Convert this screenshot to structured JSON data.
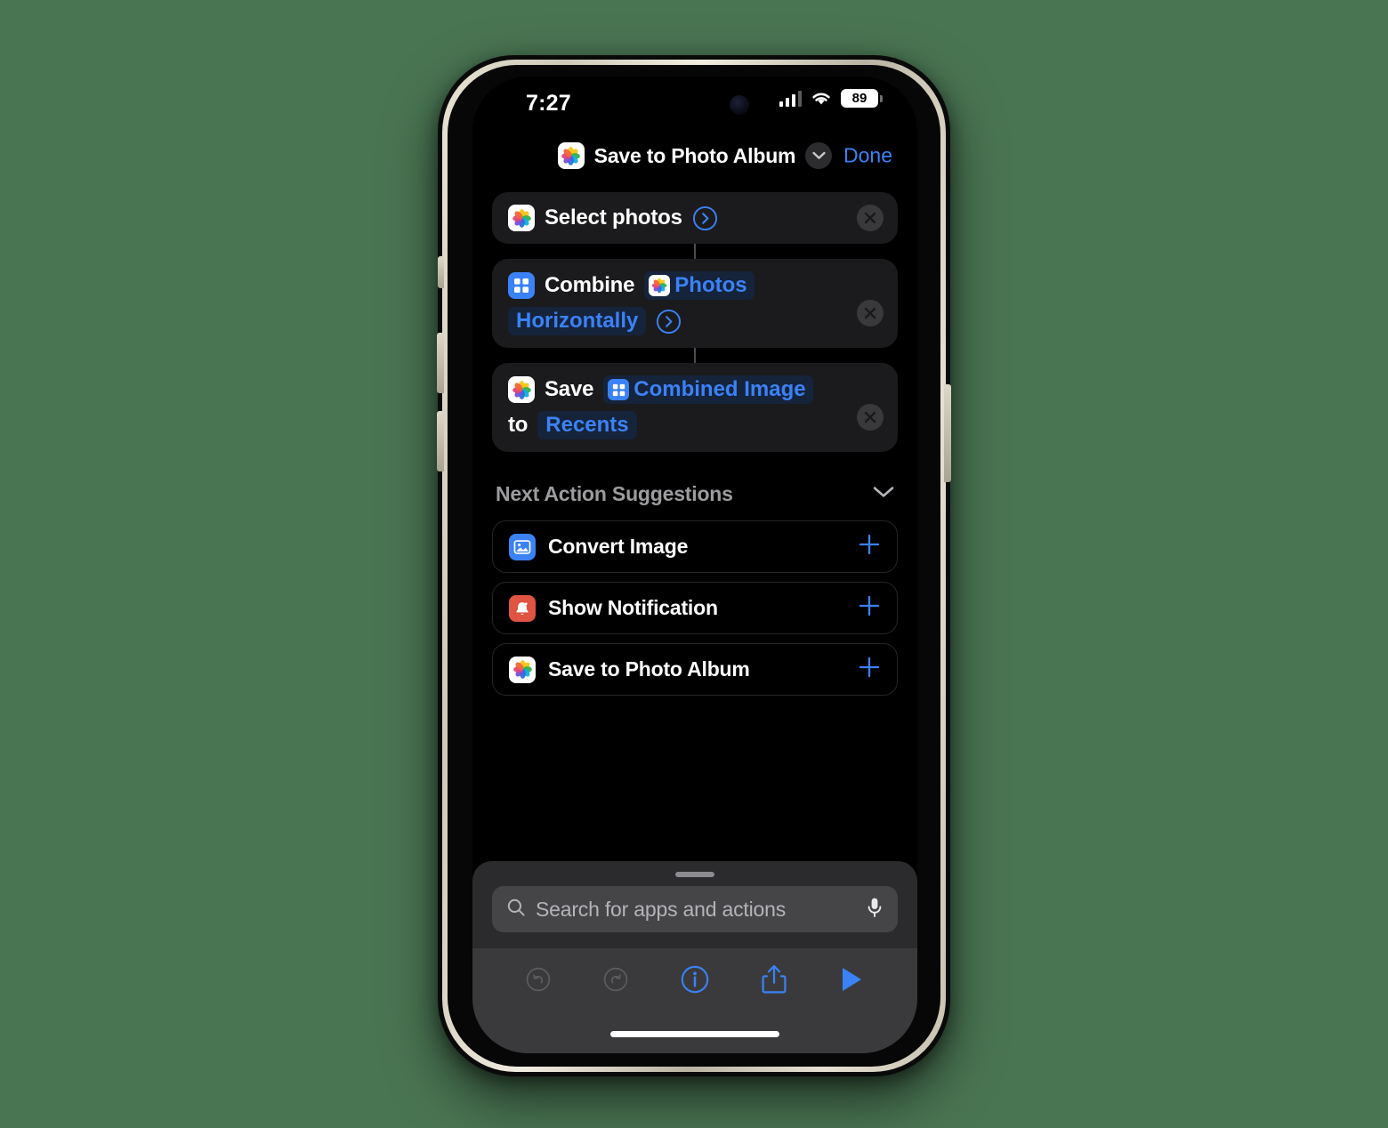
{
  "background_color": "#4a7553",
  "statusbar": {
    "time": "7:27",
    "battery_level": "89",
    "signal_icon": "cellular-bars-icon",
    "wifi_icon": "wifi-icon",
    "battery_icon": "battery-icon"
  },
  "navbar": {
    "app_icon": "photos-app-icon",
    "title": "Save to Photo Album",
    "dropdown_icon": "chevron-down-icon",
    "done_label": "Done"
  },
  "actions": [
    {
      "icon": "photos-app-icon",
      "icon_style": "photos",
      "lines": [
        {
          "parts": [
            {
              "kind": "text",
              "text": "Select photos"
            },
            {
              "kind": "go",
              "icon": "chevron-right-circle-icon"
            }
          ]
        }
      ],
      "close_icon": "close-circle-icon"
    },
    {
      "icon": "grid-icon",
      "icon_style": "blue-grid",
      "lines": [
        {
          "parts": [
            {
              "kind": "text",
              "text": "Combine"
            },
            {
              "kind": "token-icon",
              "text": "Photos",
              "icon": "photos-app-icon"
            }
          ]
        },
        {
          "parts": [
            {
              "kind": "token",
              "text": "Horizontally"
            },
            {
              "kind": "go",
              "icon": "chevron-right-circle-icon"
            }
          ]
        }
      ],
      "close_icon": "close-circle-icon"
    },
    {
      "icon": "photos-app-icon",
      "icon_style": "photos",
      "lines": [
        {
          "parts": [
            {
              "kind": "text",
              "text": "Save"
            },
            {
              "kind": "token-icon",
              "text": "Combined Image",
              "icon": "grid-icon"
            }
          ]
        },
        {
          "parts": [
            {
              "kind": "text",
              "text": "to"
            },
            {
              "kind": "token",
              "text": "Recents"
            }
          ]
        }
      ],
      "close_icon": "close-circle-icon"
    }
  ],
  "suggestions": {
    "header": "Next Action Suggestions",
    "collapse_icon": "chevron-down-icon",
    "items": [
      {
        "label": "Convert Image",
        "icon": "image-icon",
        "icon_style": "blue-image",
        "add_icon": "plus-icon"
      },
      {
        "label": "Show Notification",
        "icon": "bell-icon",
        "icon_style": "red-bell",
        "add_icon": "plus-icon"
      },
      {
        "label": "Save to Photo Album",
        "icon": "photos-app-icon",
        "icon_style": "photos",
        "add_icon": "plus-icon"
      }
    ]
  },
  "search": {
    "placeholder": "Search for apps and actions",
    "search_icon": "search-icon",
    "mic_icon": "microphone-icon"
  },
  "toolbar": {
    "items": [
      {
        "name": "undo-button",
        "icon": "undo-icon",
        "state": "disabled"
      },
      {
        "name": "redo-button",
        "icon": "redo-icon",
        "state": "disabled"
      },
      {
        "name": "info-button",
        "icon": "info-circle-icon",
        "state": "enabled"
      },
      {
        "name": "share-button",
        "icon": "share-icon",
        "state": "enabled"
      },
      {
        "name": "run-button",
        "icon": "play-icon",
        "state": "enabled"
      }
    ]
  },
  "colors": {
    "accent_blue": "#3b82f6",
    "card_bg": "#1b1b1d",
    "token_bg": "#15233b",
    "screen_bg": "#000000",
    "red_icon": "#e05443"
  }
}
